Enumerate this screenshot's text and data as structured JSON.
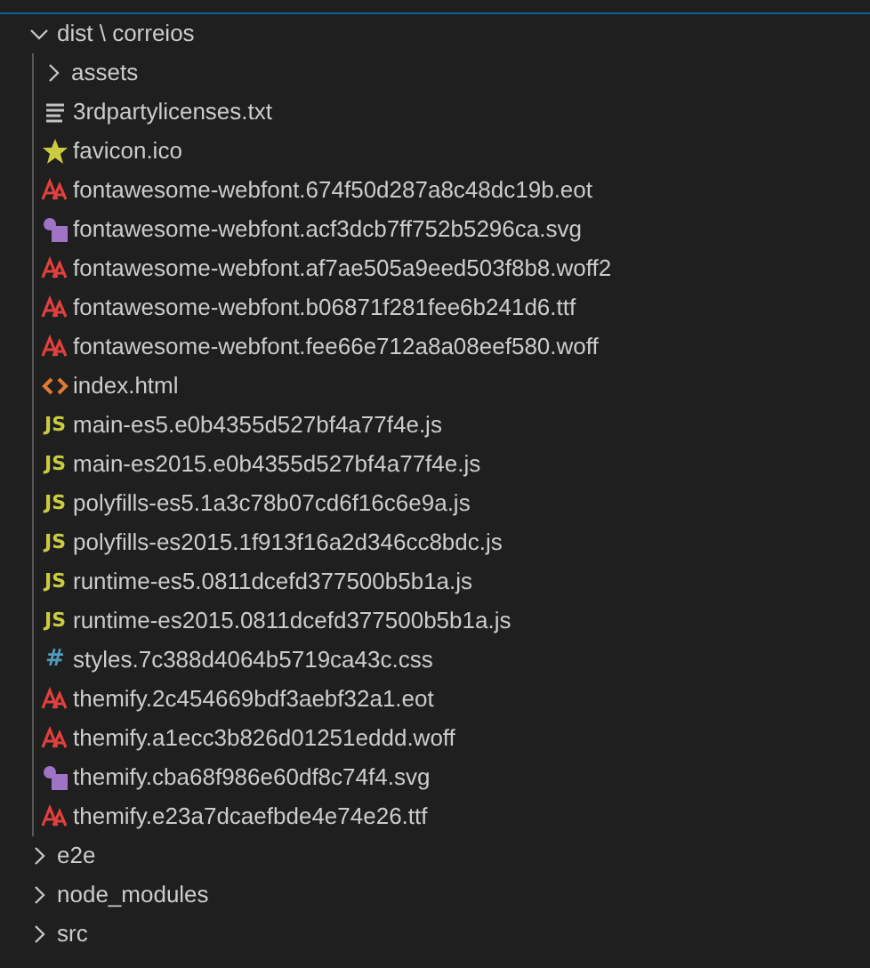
{
  "tree": [
    {
      "kind": "folder",
      "label": "dist \\ correios",
      "expanded": true,
      "children": [
        {
          "kind": "folder",
          "label": "assets",
          "expanded": false
        },
        {
          "kind": "text",
          "label": "3rdpartylicenses.txt"
        },
        {
          "kind": "favicon",
          "label": "favicon.ico"
        },
        {
          "kind": "font",
          "label": "fontawesome-webfont.674f50d287a8c48dc19b.eot"
        },
        {
          "kind": "svg",
          "label": "fontawesome-webfont.acf3dcb7ff752b5296ca.svg"
        },
        {
          "kind": "font",
          "label": "fontawesome-webfont.af7ae505a9eed503f8b8.woff2"
        },
        {
          "kind": "font",
          "label": "fontawesome-webfont.b06871f281fee6b241d6.ttf"
        },
        {
          "kind": "font",
          "label": "fontawesome-webfont.fee66e712a8a08eef580.woff"
        },
        {
          "kind": "html",
          "label": "index.html"
        },
        {
          "kind": "js",
          "icon": "JS",
          "label": "main-es5.e0b4355d527bf4a77f4e.js"
        },
        {
          "kind": "js",
          "icon": "JS",
          "label": "main-es2015.e0b4355d527bf4a77f4e.js"
        },
        {
          "kind": "js",
          "icon": "JS",
          "label": "polyfills-es5.1a3c78b07cd6f16c6e9a.js"
        },
        {
          "kind": "js",
          "icon": "JS",
          "label": "polyfills-es2015.1f913f16a2d346cc8bdc.js"
        },
        {
          "kind": "js",
          "icon": "JS",
          "label": "runtime-es5.0811dcefd377500b5b1a.js"
        },
        {
          "kind": "js",
          "icon": "JS",
          "label": "runtime-es2015.0811dcefd377500b5b1a.js"
        },
        {
          "kind": "css",
          "icon": "#",
          "label": "styles.7c388d4064b5719ca43c.css"
        },
        {
          "kind": "font",
          "label": "themify.2c454669bdf3aebf32a1.eot"
        },
        {
          "kind": "font",
          "label": "themify.a1ecc3b826d01251eddd.woff"
        },
        {
          "kind": "svg",
          "label": "themify.cba68f986e60df8c74f4.svg"
        },
        {
          "kind": "font",
          "label": "themify.e23a7dcaefbde4e74e26.ttf"
        }
      ]
    },
    {
      "kind": "folder",
      "label": "e2e",
      "expanded": false
    },
    {
      "kind": "folder",
      "label": "node_modules",
      "expanded": false
    },
    {
      "kind": "folder",
      "label": "src",
      "expanded": false
    }
  ]
}
